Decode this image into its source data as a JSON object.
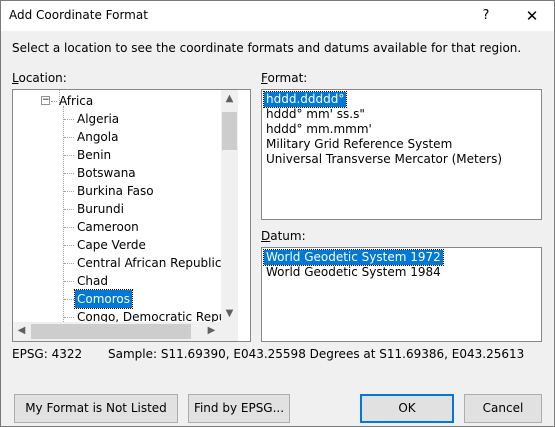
{
  "window": {
    "title": "Add Coordinate Format",
    "help_label": "?",
    "close_label": "✕"
  },
  "instruction": "Select a location to see the coordinate formats and datums available for that region.",
  "location": {
    "label_prefix": "",
    "label_underlined": "L",
    "label_rest": "ocation:",
    "parent": "Africa",
    "items": [
      "Algeria",
      "Angola",
      "Benin",
      "Botswana",
      "Burkina Faso",
      "Burundi",
      "Cameroon",
      "Cape Verde",
      "Central African Republic",
      "Chad",
      "Comoros",
      "Congo, Democratic Republi"
    ],
    "selected": "Comoros"
  },
  "format": {
    "label_underlined": "F",
    "label_rest": "ormat:",
    "items": [
      "hddd.ddddd°",
      "hddd° mm' ss.s\"",
      "hddd° mm.mmm'",
      "Military Grid Reference System",
      "Universal Transverse Mercator (Meters)"
    ],
    "selected_index": 0
  },
  "datum": {
    "label_underlined": "D",
    "label_rest": "atum:",
    "items": [
      "World Geodetic System 1972",
      "World Geodetic System 1984"
    ],
    "selected_index": 0
  },
  "epsg_text": "EPSG: 4322",
  "sample_text": "Sample: S11.69390, E043.25598 Degrees at S11.69386, E043.25613",
  "buttons": {
    "not_listed": "My Format is Not Listed",
    "find_epsg": "Find by EPSG...",
    "ok": "OK",
    "cancel": "Cancel"
  },
  "scroll_arrows": {
    "up": "▲",
    "down": "▼",
    "left": "◀",
    "right": "▶"
  }
}
